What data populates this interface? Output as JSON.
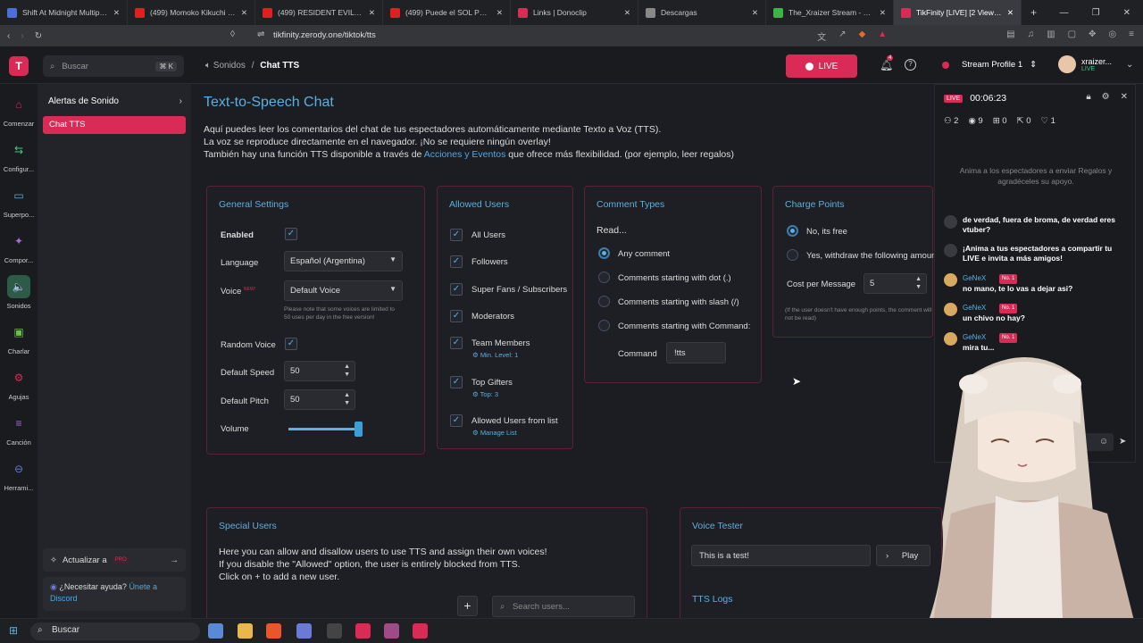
{
  "browser": {
    "tabs": [
      {
        "title": "Shift At Midnight Multiplayer D",
        "color": "#4a6fd6"
      },
      {
        "title": "(499) Momoko Kikuchi - Gl",
        "color": "#e02020"
      },
      {
        "title": "(499) RESIDENT EVIL 9 REQUIE",
        "color": "#e02020"
      },
      {
        "title": "(499) Puede el SOL PERUANO",
        "color": "#e02020"
      },
      {
        "title": "Links | Donoclip",
        "color": "#d92b55"
      },
      {
        "title": "Descargas",
        "color": "#888888"
      },
      {
        "title": "The_Xraizer Stream - Watc",
        "color": "#3ab54a"
      },
      {
        "title": "TikFinity [LIVE] [2 Viewers]",
        "color": "#d92b55"
      }
    ],
    "url": "tikfinity.zerody.one/tiktok/tts"
  },
  "app": {
    "search_placeholder": "Buscar",
    "search_shortcut": "⌘ K",
    "breadcrumb_parent": "Sonidos",
    "breadcrumb_sep": "/",
    "breadcrumb_current": "Chat TTS",
    "live_label": "LIVE",
    "notif_count": "4",
    "profile_label": "Stream Profile 1",
    "username": "xraizer...",
    "user_status": "LIVE"
  },
  "rail": [
    {
      "label": "Comenzar",
      "icon": "home-icon",
      "glyph": "⌂",
      "color": "#d92b55"
    },
    {
      "label": "Configur...",
      "icon": "sliders-icon",
      "glyph": "⇆",
      "color": "#4cc38a"
    },
    {
      "label": "Superpo...",
      "icon": "monitor-icon",
      "glyph": "▭",
      "color": "#5ab0e0"
    },
    {
      "label": "Compor...",
      "icon": "magic-icon",
      "glyph": "✦",
      "color": "#a46ad6"
    },
    {
      "label": "Sonidos",
      "icon": "speaker-icon",
      "glyph": "🔈",
      "color": "#4cc38a"
    },
    {
      "label": "Charlar",
      "icon": "chat-icon",
      "glyph": "▣",
      "color": "#6cc04a"
    },
    {
      "label": "Agujas",
      "icon": "gauge-icon",
      "glyph": "⚙",
      "color": "#d92b55"
    },
    {
      "label": "Canción",
      "icon": "music-icon",
      "glyph": "≡",
      "color": "#a46ad6"
    },
    {
      "label": "Herrami...",
      "icon": "gamepad-icon",
      "glyph": "⊖",
      "color": "#6a7ad6"
    }
  ],
  "sidenav": {
    "alerts": "Alertas de Sonido",
    "tts": "Chat TTS",
    "upgrade": "Actualizar a",
    "pro": "PRO",
    "help_q": "¿Necesitar ayuda?",
    "help_link": "Únete a Discord"
  },
  "page": {
    "title": "Text-to-Speech Chat",
    "intro1": "Aquí puedes leer los comentarios del chat de tus espectadores automáticamente mediante Texto a Voz (TTS).",
    "intro2": "La voz se reproduce directamente en el navegador. ¡No se requiere ningún overlay!",
    "intro3a": "También hay una función TTS disponible a través de ",
    "intro3link": "Acciones y Eventos",
    "intro3b": " que ofrece más flexibilidad. (por ejemplo, leer regalos)"
  },
  "general": {
    "title": "General Settings",
    "enabled": "Enabled",
    "language": "Language",
    "language_value": "Español (Argentina)",
    "voice": "Voice",
    "voice_new": "NEW!",
    "voice_value": "Default Voice",
    "voice_note": "Please note that some voices are limited to 50 uses per day in the free version!",
    "random_voice": "Random Voice",
    "default_speed": "Default Speed",
    "speed_value": "50",
    "default_pitch": "Default Pitch",
    "pitch_value": "50",
    "volume": "Volume",
    "volume_level": 0.95
  },
  "allowed": {
    "title": "Allowed Users",
    "items": [
      {
        "label": "All Users",
        "checked": true,
        "sub": ""
      },
      {
        "label": "Followers",
        "checked": true,
        "sub": ""
      },
      {
        "label": "Super Fans / Subscribers",
        "checked": true,
        "sub": ""
      },
      {
        "label": "Moderators",
        "checked": true,
        "sub": ""
      },
      {
        "label": "Team Members",
        "checked": true,
        "sub": "Min. Level: 1"
      },
      {
        "label": "Top Gifters",
        "checked": true,
        "sub": "Top: 3"
      },
      {
        "label": "Allowed Users from list",
        "checked": true,
        "sub": "Manage List"
      }
    ]
  },
  "comment_types": {
    "title": "Comment Types",
    "read": "Read...",
    "options": [
      "Any comment",
      "Comments starting with dot (.)",
      "Comments starting with slash (/)",
      "Comments starting with Command:"
    ],
    "selected": 0,
    "command_label": "Command",
    "command_value": "!tts"
  },
  "charge": {
    "title": "Charge Points",
    "options": [
      "No, its free",
      "Yes, withdraw the following amount"
    ],
    "selected": 0,
    "cost_label": "Cost per Message",
    "cost_value": "5",
    "note": "(If the user doesn't have enough points, the comment will not be read)"
  },
  "special": {
    "title": "Special Users",
    "line1": "Here you can allow and disallow users to use TTS and assign their own voices!",
    "line2": "If you disable the \"Allowed\" option, the user is entirely blocked from TTS.",
    "line3": "Click on + to add a new user.",
    "search_placeholder": "Search users..."
  },
  "tester": {
    "title": "Voice Tester",
    "text": "This is a test!",
    "play": "Play",
    "logs": "TTS Logs"
  },
  "stream": {
    "live_tag": "LIVE",
    "timer": "00:06:23",
    "stats": [
      "2",
      "9",
      "0",
      "0",
      "1"
    ],
    "encourage": "Anima a los espectadores a enviar Regalos y agradéceles su apoyo.",
    "messages": [
      {
        "name": "",
        "badge": "",
        "text": "de verdad, fuera de broma, de verdad eres vtuber?"
      },
      {
        "name": "",
        "badge": "",
        "text": "¡Anima a tus espectadores a compartir tu LIVE e invita a más amigos!"
      },
      {
        "name": "GeNeX",
        "badge": "No. 1",
        "text": "no mano, te lo vas a dejar asi?"
      },
      {
        "name": "GeNeX",
        "badge": "No. 1",
        "text": "un chivo no hay?"
      },
      {
        "name": "GeNeX",
        "badge": "No. 1",
        "text": "mira tu..."
      }
    ]
  },
  "taskbar": {
    "search": "Buscar"
  }
}
